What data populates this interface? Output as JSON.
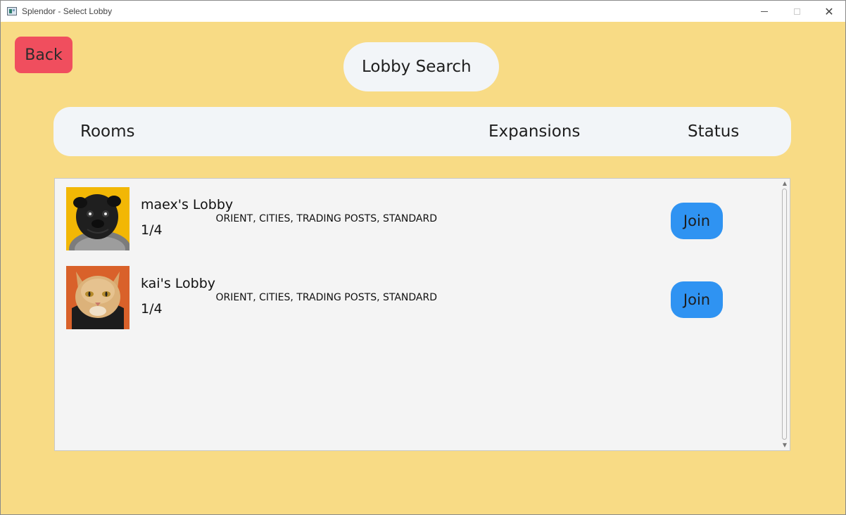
{
  "window": {
    "title": "Splendor - Select Lobby",
    "controls": {
      "minimize": "—",
      "maximize": "□",
      "close": "✕"
    }
  },
  "back_label": "Back",
  "search_title": "Lobby Search",
  "columns": {
    "rooms": "Rooms",
    "expansions": "Expansions",
    "status": "Status"
  },
  "lobbies": [
    {
      "name": "maex's Lobby",
      "players": "1/4",
      "expansions": "ORIENT, CITIES, TRADING POSTS, STANDARD",
      "join_label": "Join",
      "avatar_icon": "pug-avatar",
      "avatar_color": "#f2b705"
    },
    {
      "name": "kai's Lobby",
      "players": "1/4",
      "expansions": "ORIENT, CITIES, TRADING POSTS, STANDARD",
      "join_label": "Join",
      "avatar_icon": "cat-avatar",
      "avatar_color": "#d9612a"
    }
  ],
  "colors": {
    "background": "#f8db85",
    "back_button": "#f04e5e",
    "join_button": "#2f93f2",
    "panel": "#f2f5f8"
  }
}
